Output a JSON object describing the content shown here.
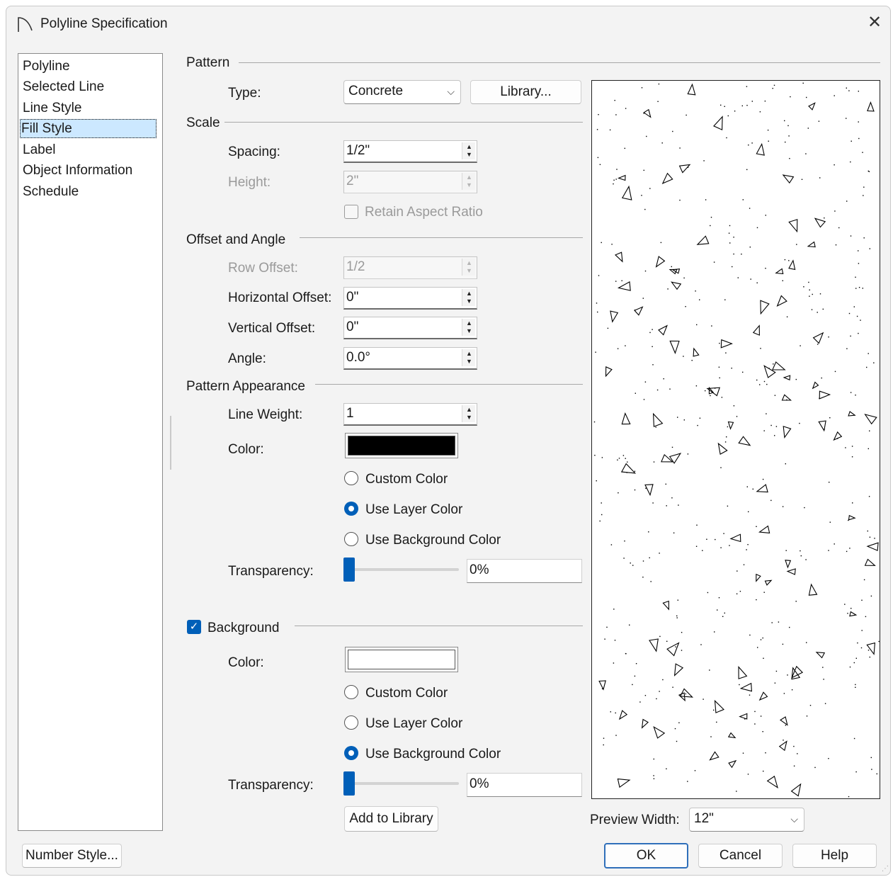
{
  "window": {
    "title": "Polyline Specification",
    "app_icon": "arc-icon",
    "close_icon": "close-icon"
  },
  "nav": {
    "items": [
      {
        "label": "Polyline",
        "selected": false
      },
      {
        "label": "Selected Line",
        "selected": false
      },
      {
        "label": "Line Style",
        "selected": false
      },
      {
        "label": "Fill Style",
        "selected": true
      },
      {
        "label": "Label",
        "selected": false
      },
      {
        "label": "Object Information",
        "selected": false
      },
      {
        "label": "Schedule",
        "selected": false
      }
    ]
  },
  "pattern": {
    "section": "Pattern",
    "type_label": "Type:",
    "type_value": "Concrete",
    "library_button": "Library..."
  },
  "scale": {
    "section": "Scale",
    "spacing_label": "Spacing:",
    "spacing_value": "1/2\"",
    "height_label": "Height:",
    "height_value": "2\"",
    "retain_label": "Retain Aspect Ratio",
    "retain_checked": false
  },
  "offset": {
    "section": "Offset and Angle",
    "row_offset_label": "Row Offset:",
    "row_offset_value": "1/2",
    "h_offset_label": "Horizontal Offset:",
    "h_offset_value": "0\"",
    "v_offset_label": "Vertical Offset:",
    "v_offset_value": "0\"",
    "angle_label": "Angle:",
    "angle_value": "0.0°"
  },
  "appearance": {
    "section": "Pattern Appearance",
    "line_weight_label": "Line Weight:",
    "line_weight_value": "1",
    "color_label": "Color:",
    "color_value": "#000000",
    "radio_custom": "Custom Color",
    "radio_layer": "Use Layer Color",
    "radio_background": "Use Background Color",
    "selected_radio": "Use Layer Color",
    "transparency_label": "Transparency:",
    "transparency_value": "0%",
    "transparency_fraction": 0
  },
  "background": {
    "section": "Background",
    "checked": true,
    "color_label": "Color:",
    "color_value": "#ffffff",
    "radio_custom": "Custom Color",
    "radio_layer": "Use Layer Color",
    "radio_background": "Use Background Color",
    "selected_radio": "Use Background Color",
    "transparency_label": "Transparency:",
    "transparency_value": "0%",
    "transparency_fraction": 0,
    "add_to_library": "Add to Library"
  },
  "preview": {
    "width_label": "Preview Width:",
    "width_value": "12\""
  },
  "footer": {
    "number_style": "Number Style...",
    "ok": "OK",
    "cancel": "Cancel",
    "help": "Help"
  },
  "colors": {
    "accent": "#005fb8",
    "selection": "#cce8ff"
  }
}
